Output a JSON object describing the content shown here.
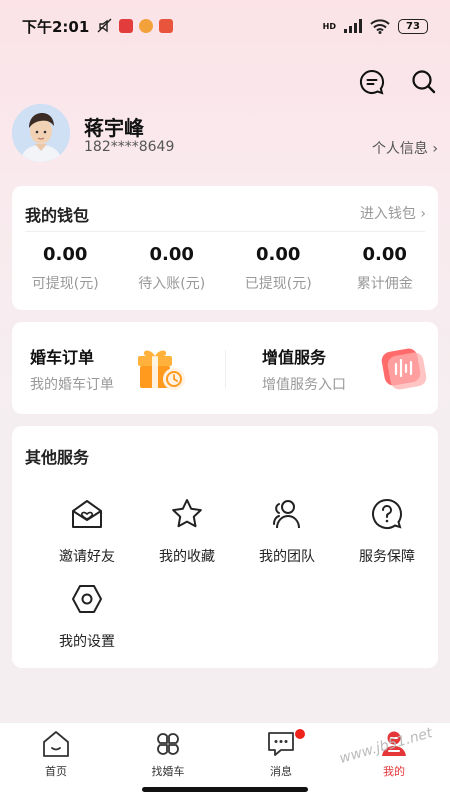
{
  "status_bar": {
    "time": "下午2:01",
    "battery": "73",
    "network": "HD"
  },
  "profile": {
    "name": "蒋宇峰",
    "phone": "182****8649",
    "info_link": "个人信息"
  },
  "wallet": {
    "title": "我的钱包",
    "enter_link": "进入钱包",
    "stats": [
      {
        "value": "0.00",
        "label": "可提现(元)"
      },
      {
        "value": "0.00",
        "label": "待入账(元)"
      },
      {
        "value": "0.00",
        "label": "已提现(元)"
      },
      {
        "value": "0.00",
        "label": "累计佣金"
      }
    ]
  },
  "orders": {
    "left": {
      "title": "婚车订单",
      "subtitle": "我的婚车订单"
    },
    "right": {
      "title": "增值服务",
      "subtitle": "增值服务入口"
    }
  },
  "services": {
    "title": "其他服务",
    "items": [
      {
        "label": "邀请好友",
        "icon": "envelope-heart-icon"
      },
      {
        "label": "我的收藏",
        "icon": "star-icon"
      },
      {
        "label": "我的团队",
        "icon": "team-icon"
      },
      {
        "label": "服务保障",
        "icon": "help-circle-icon"
      },
      {
        "label": "我的设置",
        "icon": "settings-hexagon-icon"
      }
    ]
  },
  "tabbar": {
    "items": [
      {
        "label": "首页",
        "icon": "home-icon"
      },
      {
        "label": "找婚车",
        "icon": "clover-icon"
      },
      {
        "label": "消息",
        "icon": "message-icon"
      },
      {
        "label": "我的",
        "icon": "profile-icon"
      }
    ]
  },
  "watermark": "www.jb51.net",
  "colors": {
    "accent": "#e5373a",
    "background": "#f5eef0",
    "header_gradient_top": "#fbe3e7"
  }
}
